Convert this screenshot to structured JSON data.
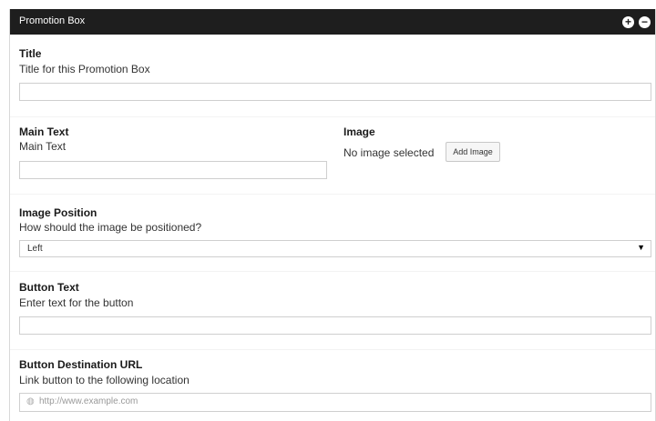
{
  "box": {
    "title": "Promotion Box",
    "expand_icon": "plus-circle-icon",
    "collapse_icon": "minus-circle-icon"
  },
  "fields": {
    "title": {
      "label": "Title",
      "description": "Title for this Promotion Box",
      "value": ""
    },
    "main_text": {
      "label": "Main Text",
      "description": "Main Text",
      "value": ""
    },
    "image": {
      "label": "Image",
      "status": "No image selected",
      "button_label": "Add Image"
    },
    "image_position": {
      "label": "Image Position",
      "description": "How should the image be positioned?",
      "selected": "Left"
    },
    "button_text": {
      "label": "Button Text",
      "description": "Enter text for the button",
      "value": ""
    },
    "button_url": {
      "label": "Button Destination URL",
      "description": "Link button to the following location",
      "placeholder": "http://www.example.com",
      "icon": "globe-icon"
    }
  }
}
